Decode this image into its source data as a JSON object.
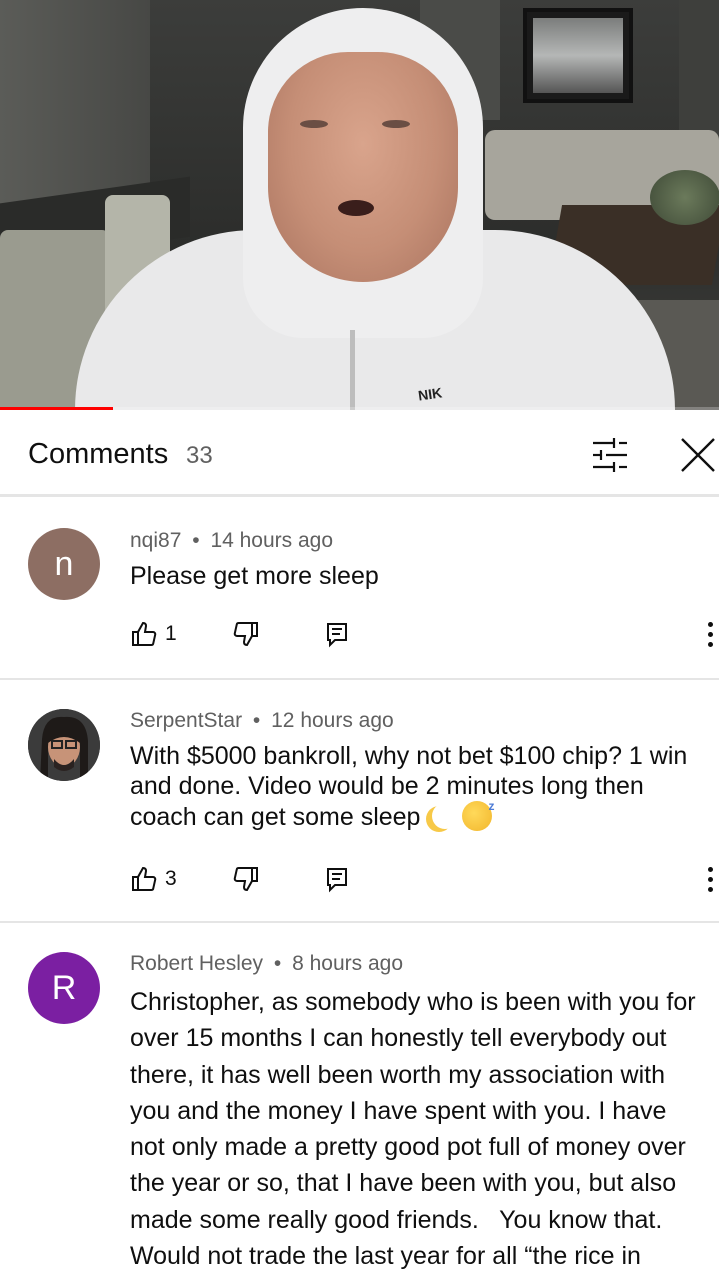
{
  "video": {
    "shirt_text": "NIK",
    "progress_percent": 15.7,
    "progress_color": "#ff0000"
  },
  "header": {
    "title": "Comments",
    "count": "33",
    "filter_icon": "sort-filter-icon",
    "close_icon": "close-icon"
  },
  "comments": [
    {
      "avatar_letter": "n",
      "avatar_color": "#8d6e63",
      "author": "nqi87",
      "time": "14 hours ago",
      "text": "Please get more sleep",
      "likes": "1"
    },
    {
      "avatar_letter": "",
      "avatar_color": "#3a3a3a",
      "author": "SerpentStar",
      "time": "12 hours ago",
      "text": "With $5000 bankroll, why not bet $100 chip? 1 win and done. Video would be 2 minutes long then coach can get some sleep",
      "likes": "3"
    },
    {
      "avatar_letter": "R",
      "avatar_color": "#7b1fa2",
      "author": "Robert Hesley",
      "time": "8 hours ago",
      "text": "Christopher, as somebody who is been with you for over 15 months I can honestly tell everybody out there, it has well been worth my association with you and the money I have spent with you. I have not only made a pretty good pot full of money over the year or so, that I have been with you, but also made some really good friends.   You know that.  Would not trade the last year for all “the rice in China “.",
      "likes": ""
    }
  ],
  "separator": "•"
}
